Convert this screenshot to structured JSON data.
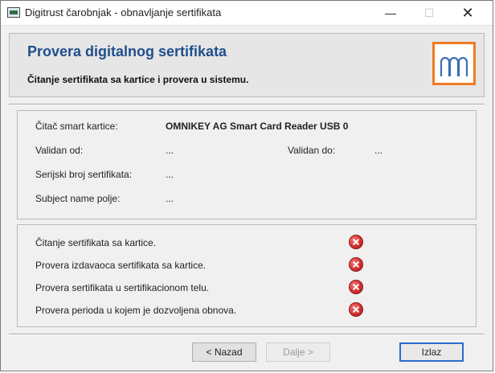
{
  "window": {
    "title": "Digitrust čarobnjak - obnavljanje sertifikata",
    "minimize_glyph": "—",
    "maximize_glyph": "☐",
    "close_glyph": "✕"
  },
  "header": {
    "title": "Provera digitalnog sertifikata",
    "subtitle": "Čitanje sertifikata sa kartice i provera u sistemu.",
    "logo_color": "#f07b22"
  },
  "info": {
    "reader_label": "Čitač smart kartice:",
    "reader_value": "OMNIKEY AG Smart Card Reader USB 0",
    "valid_from_label": "Validan od:",
    "valid_from_value": "...",
    "valid_to_label": "Validan do:",
    "valid_to_value": "...",
    "serial_label": "Serijski broj sertifikata:",
    "serial_value": "...",
    "subject_label": "Subject name polje:",
    "subject_value": "..."
  },
  "checks": [
    {
      "label": "Čitanje sertifikata sa kartice.",
      "status": "error-icon"
    },
    {
      "label": "Provera izdavaoca sertifikata sa kartice.",
      "status": "error-icon"
    },
    {
      "label": "Provera sertifikata u sertifikacionom telu.",
      "status": "error-icon"
    },
    {
      "label": "Provera perioda u kojem je dozvoljena obnova.",
      "status": "error-icon"
    }
  ],
  "buttons": {
    "back": "< Nazad",
    "next": "Dalje >",
    "exit": "Izlaz"
  },
  "colors": {
    "title_blue": "#1f4f8c",
    "error_red": "#d62f2f",
    "default_button_border": "#2d6bcf"
  }
}
